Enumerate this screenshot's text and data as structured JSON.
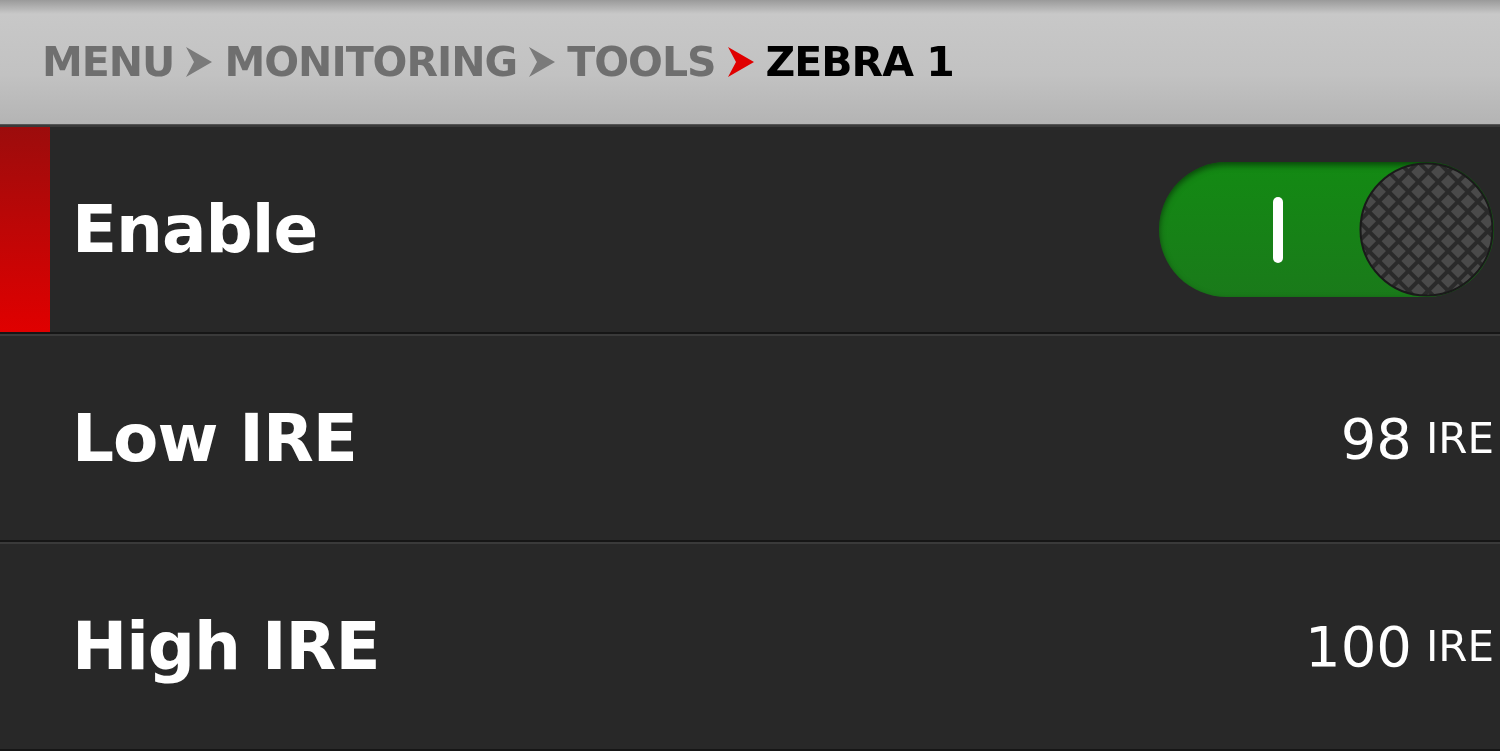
{
  "breadcrumb": [
    {
      "label": "MENU",
      "current": false
    },
    {
      "label": "MONITORING",
      "current": false
    },
    {
      "label": "TOOLS",
      "current": false
    },
    {
      "label": "ZEBRA 1",
      "current": true
    }
  ],
  "rows": [
    {
      "kind": "toggle",
      "label": "Enable",
      "selected": true,
      "on": true
    },
    {
      "kind": "value",
      "label": "Low IRE",
      "selected": false,
      "value": "98",
      "unit": "IRE"
    },
    {
      "kind": "value",
      "label": "High IRE",
      "selected": false,
      "value": "100",
      "unit": "IRE"
    }
  ]
}
